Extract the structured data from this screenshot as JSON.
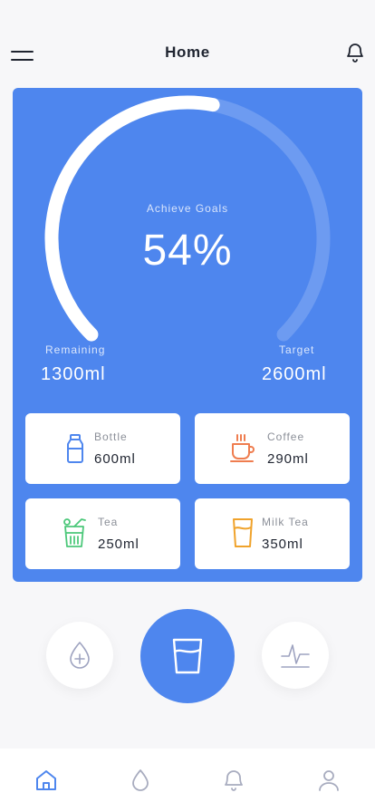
{
  "header": {
    "title": "Home"
  },
  "progress": {
    "percent_value": 54,
    "percent_text": "54%",
    "label": "Achieve Goals",
    "remaining_label": "Remaining",
    "remaining_value": "1300ml",
    "target_label": "Target",
    "target_value": "2600ml"
  },
  "drinks": [
    {
      "name": "Bottle",
      "amount": "600ml",
      "icon": "bottle-icon",
      "color": "#4e86ee"
    },
    {
      "name": "Coffee",
      "amount": "290ml",
      "icon": "coffee-cup-icon",
      "color": "#ef7d4f"
    },
    {
      "name": "Tea",
      "amount": "250ml",
      "icon": "tea-glass-icon",
      "color": "#4cc87a"
    },
    {
      "name": "Milk Tea",
      "amount": "350ml",
      "icon": "milk-tea-cup-icon",
      "color": "#f0a32c"
    }
  ],
  "actions": [
    {
      "icon": "add-drop-icon"
    },
    {
      "icon": "glass-of-water-icon"
    },
    {
      "icon": "activity-chart-icon"
    }
  ],
  "nav": [
    {
      "icon": "home-icon",
      "active": true
    },
    {
      "icon": "drop-icon",
      "active": false
    },
    {
      "icon": "bell-icon",
      "active": false
    },
    {
      "icon": "profile-icon",
      "active": false
    }
  ],
  "colors": {
    "accent": "#4e86ee",
    "background": "#f7f7f9",
    "text": "#1f2430",
    "muted": "#8b8f98"
  }
}
